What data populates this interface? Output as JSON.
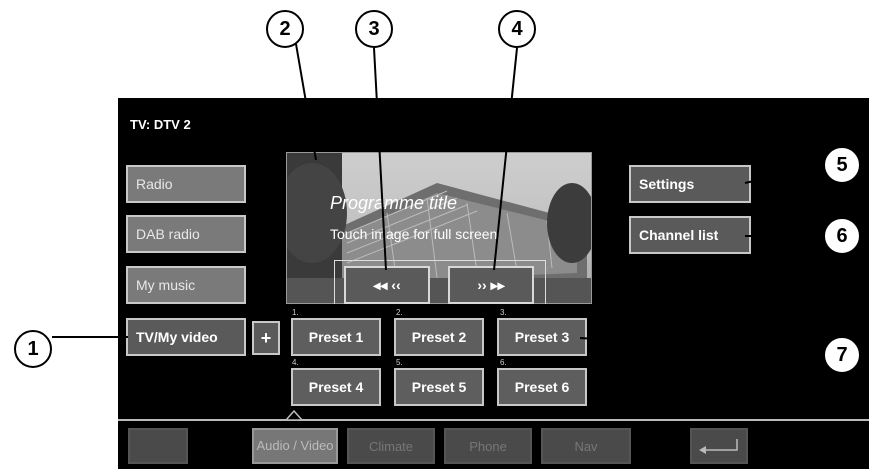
{
  "header": {
    "title": "TV: DTV 2"
  },
  "sources": {
    "radio": "Radio",
    "dab_radio": "DAB radio",
    "my_music": "My music",
    "tv_video": "TV/My video",
    "plus": "+"
  },
  "right": {
    "settings": "Settings",
    "channel_list": "Channel list"
  },
  "video": {
    "programme_title": "Programme title",
    "hint": "Touch image for full screen"
  },
  "transport": {
    "prev": "◂◂ ‹‹",
    "next": "›› ▸▸"
  },
  "presets": [
    {
      "num": "1.",
      "label": "Preset 1"
    },
    {
      "num": "2.",
      "label": "Preset 2"
    },
    {
      "num": "3.",
      "label": "Preset 3"
    },
    {
      "num": "4.",
      "label": "Preset 4"
    },
    {
      "num": "5.",
      "label": "Preset 5"
    },
    {
      "num": "6.",
      "label": "Preset 6"
    }
  ],
  "bottom_nav": {
    "audio_video": "Audio / Video",
    "climate": "Climate",
    "phone": "Phone",
    "nav": "Nav"
  },
  "callouts": [
    "1",
    "2",
    "3",
    "4",
    "5",
    "6",
    "7"
  ]
}
